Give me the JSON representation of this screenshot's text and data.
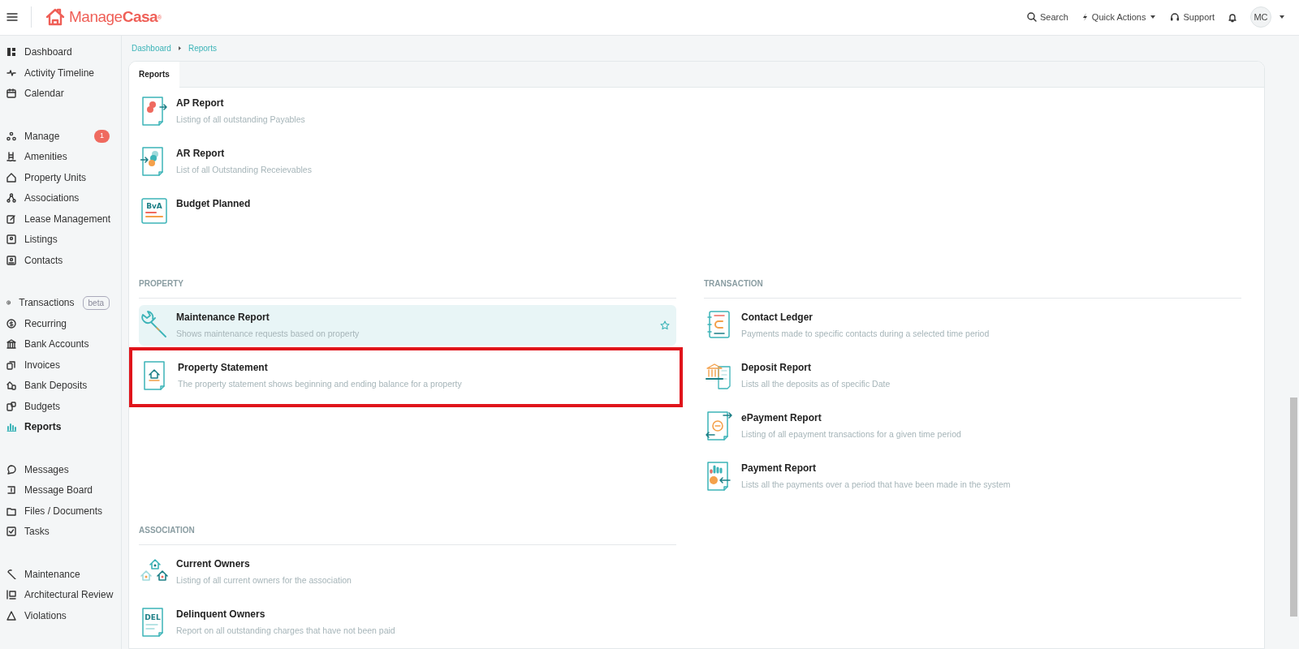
{
  "topbar": {
    "logo": "Manage**Casa**$^{®}$",
    "search": "Search",
    "quick_actions": "Quick Actions",
    "support": "Support",
    "avatar": "MC"
  },
  "sidebar": {
    "groups": [
      [
        {
          "label": "Dashboard",
          "selected": false
        },
        {
          "label": "Activity Timeline",
          "selected": false
        },
        {
          "label": "Calendar",
          "selected": false
        }
      ],
      [
        {
          "label": "Manage",
          "selected": false,
          "badge": "1"
        },
        {
          "label": "Amenities",
          "selected": false
        },
        {
          "label": "Property Units",
          "selected": false
        },
        {
          "label": "Associations",
          "selected": false
        },
        {
          "label": "Lease Management",
          "selected": false
        },
        {
          "label": "Listings",
          "selected": false
        },
        {
          "label": "Contacts",
          "selected": false
        }
      ],
      [
        {
          "label": "Transactions",
          "selected": false,
          "tag": "beta"
        },
        {
          "label": "Recurring",
          "selected": false
        },
        {
          "label": "Bank Accounts",
          "selected": false
        },
        {
          "label": "Invoices",
          "selected": false
        },
        {
          "label": "Bank Deposits",
          "selected": false
        },
        {
          "label": "Budgets",
          "selected": false
        },
        {
          "label": "Reports",
          "selected": true
        }
      ],
      [
        {
          "label": "Messages",
          "selected": false
        },
        {
          "label": "Message Board",
          "selected": false
        },
        {
          "label": "Files / Documents",
          "selected": false
        },
        {
          "label": "Tasks",
          "selected": false
        }
      ],
      [
        {
          "label": "Maintenance",
          "selected": false
        },
        {
          "label": "Architectural Review",
          "selected": false
        },
        {
          "label": "Violations",
          "selected": false
        }
      ]
    ]
  },
  "breadcrumb": [
    "Dashboard",
    "Reports"
  ],
  "tabs": [
    {
      "label": "Reports",
      "selected": true
    }
  ],
  "report_groups": [
    {
      "items": [
        {
          "title": "AP Report",
          "description": "Listing of all outstanding Payables",
          "hovered": false,
          "highlighted": false
        },
        {
          "title": "AR Report",
          "description": "List of all Outstanding Receievables",
          "hovered": false,
          "highlighted": false
        },
        {
          "title": "Budget Planned",
          "icon_text": "BvA",
          "hovered": false,
          "highlighted": false
        }
      ]
    },
    {
      "heading": "PROPERTY",
      "items": [
        {
          "title": "Maintenance Report",
          "description": "Shows maintenance requests based on property",
          "hovered": true,
          "highlighted": false
        },
        {
          "title": "Property Statement",
          "description": "The property statement shows beginning and ending balance for a property",
          "hovered": false,
          "highlighted": true
        }
      ]
    },
    {
      "heading": "TRANSACTION",
      "items": [
        {
          "title": "Contact Ledger",
          "description": "Payments made to specific contacts during a selected time period",
          "hovered": false,
          "highlighted": false
        },
        {
          "title": "Deposit Report",
          "description": "Lists all the deposits as of specific Date",
          "hovered": false,
          "highlighted": false
        },
        {
          "title": "ePayment Report",
          "description": "Listing of all epayment transactions for a given time period",
          "hovered": false,
          "highlighted": false
        },
        {
          "title": "Payment Report",
          "description": "Lists all the payments over a period that have been made in the system",
          "hovered": false,
          "highlighted": false
        }
      ]
    },
    {
      "heading": "ASSOCIATION",
      "items": [
        {
          "title": "Current Owners",
          "description": "Listing of all current owners for the association",
          "hovered": false,
          "highlighted": false
        },
        {
          "title": "Delinquent Owners",
          "description": "Report on all outstanding charges that have not been paid",
          "icon_text": "DEL",
          "hovered": false,
          "highlighted": false
        }
      ]
    }
  ]
}
